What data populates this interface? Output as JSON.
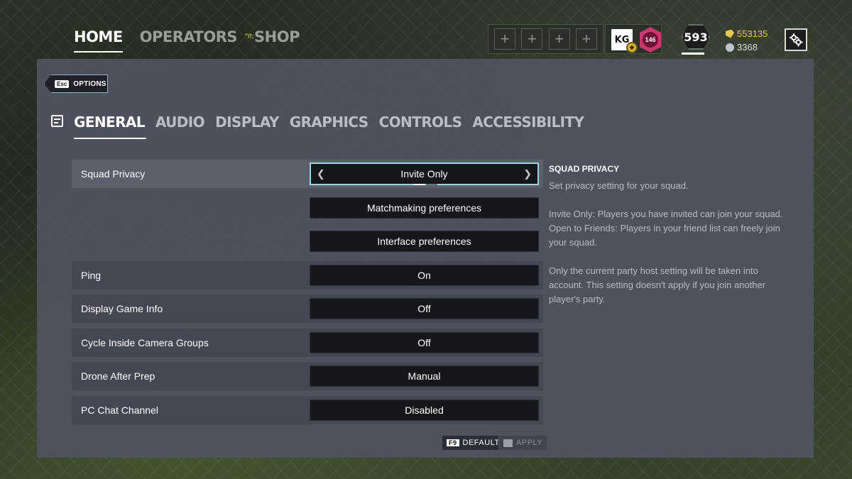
{
  "top_nav": {
    "tabs": [
      {
        "label": "HOME",
        "active": true
      },
      {
        "label": "OPERATORS",
        "active": false
      },
      {
        "label": "SHOP",
        "active": false
      }
    ],
    "shop_indicator": "\"/!:"
  },
  "squad_slots": [
    "+",
    "+",
    "+",
    "+"
  ],
  "badges": {
    "crown_text": "KG",
    "rank_number": "146"
  },
  "player": {
    "level": "593",
    "level_progress": 0.8,
    "renown": "553135",
    "credits": "3368"
  },
  "options_tag": {
    "key": "Esc",
    "label": "OPTIONS"
  },
  "sub_tabs": [
    {
      "label": "GENERAL",
      "active": true
    },
    {
      "label": "AUDIO",
      "active": false
    },
    {
      "label": "DISPLAY",
      "active": false
    },
    {
      "label": "GRAPHICS",
      "active": false
    },
    {
      "label": "CONTROLS",
      "active": false
    },
    {
      "label": "ACCESSIBILITY",
      "active": false
    }
  ],
  "settings": {
    "squad_privacy": {
      "label": "Squad Privacy",
      "value": "Invite Only"
    },
    "matchmaking_button": "Matchmaking preferences",
    "interface_button": "Interface preferences",
    "ping": {
      "label": "Ping",
      "value": "On"
    },
    "display_game_info": {
      "label": "Display Game Info",
      "value": "Off"
    },
    "cycle_camera": {
      "label": "Cycle Inside Camera Groups",
      "value": "Off"
    },
    "drone_after_prep": {
      "label": "Drone After Prep",
      "value": "Manual"
    },
    "pc_chat": {
      "label": "PC Chat Channel",
      "value": "Disabled"
    }
  },
  "description": {
    "title": "SQUAD PRIVACY",
    "summary": "Set privacy setting for your squad.",
    "invite_only": "Invite Only: Players you have invited can join your squad.",
    "open_to_friends": "Open to Friends: Players in your friend list can freely join your squad.",
    "note": "Only the current party host setting will be taken into account. This setting doesn't apply if you join another player's party."
  },
  "footer": {
    "default_key": "F9",
    "default_label": "DEFAULT",
    "apply_label": "APPLY"
  },
  "colors": {
    "accent_focus": "#9ed3e2",
    "renown": "#e6c84a",
    "rank_badge": "#c8386e",
    "panel": "#4e535e"
  }
}
